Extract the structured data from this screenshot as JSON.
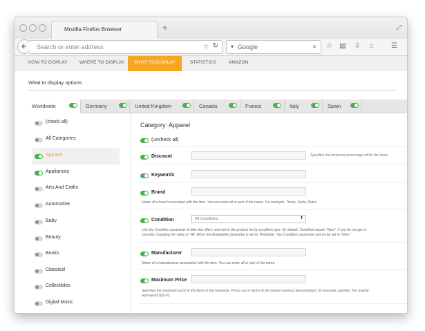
{
  "browser": {
    "tab_title": "Mozilla Firefox Browser",
    "new_tab_label": "+",
    "url_placeholder": "Search or enter address",
    "search_placeholder": "Google"
  },
  "nav": {
    "items": [
      {
        "label": "HOW TO DISPLAY"
      },
      {
        "label": "WHERE TO DISPLAY"
      },
      {
        "label": "WHAT TO DISPLAY"
      },
      {
        "label": "STATISTICS"
      },
      {
        "label": "AMAZON"
      }
    ],
    "active": "WHAT TO DISPLAY",
    "active_color": "#f5a623"
  },
  "section_title": "What to display options",
  "country_tabs": [
    {
      "label": "Worldwide",
      "on": true
    },
    {
      "label": "Germany",
      "on": true
    },
    {
      "label": "United Kingdom",
      "on": true
    },
    {
      "label": "Canada",
      "on": true
    },
    {
      "label": "France",
      "on": true
    },
    {
      "label": "Italy",
      "on": true
    },
    {
      "label": "Spain",
      "on": true
    }
  ],
  "categories": [
    {
      "label": "(check all)",
      "on": false
    },
    {
      "label": "All Categories",
      "on": false
    },
    {
      "label": "Apparel",
      "on": true
    },
    {
      "label": "Appliances",
      "on": true
    },
    {
      "label": "Arts And Crafts",
      "on": false
    },
    {
      "label": "Automotive",
      "on": false
    },
    {
      "label": "Baby",
      "on": false
    },
    {
      "label": "Beauty",
      "on": false
    },
    {
      "label": "Books",
      "on": false
    },
    {
      "label": "Classical",
      "on": false
    },
    {
      "label": "Collectibles",
      "on": false
    },
    {
      "label": "Digital Music",
      "on": false
    }
  ],
  "selected_category": "Apparel",
  "main": {
    "category_title": "Category: Apparel",
    "uncheck_all": "(uncheck all)",
    "fields": {
      "discount": {
        "label": "Discount",
        "hint": "Specifies the minimum percentage off for the items"
      },
      "keywords": {
        "label": "Keywords"
      },
      "brand": {
        "label": "Brand",
        "description": "Name of a brand associated with the item. You can enter all or part of the name. For example, Timex, Seiko, Rolex."
      },
      "condition": {
        "label": "Condition",
        "selected": "All Conditions",
        "description_1": "Use the Condition parameter to filter the offers returned in the product list by condition type. By default, Condition equals \"New\". If you do not get re",
        "description_2": "consider changing the value to \"All. When the Availability parameter is set to \"Available,\" the Condition parameter cannot be set to \"New.\""
      },
      "manufacturer": {
        "label": "Manufacturer",
        "description": "Name of a manufacturer associated with the item. You can enter all or part of the name."
      },
      "maximum_price": {
        "label": "Maximum Price",
        "description_1": "Specifies the maximum price of the items in the response. Prices are in terms of the lowest currency denomination, for example, pennies. For examp",
        "description_2": "represents $32.41."
      }
    }
  },
  "toggle_on_color": "#4caf50"
}
